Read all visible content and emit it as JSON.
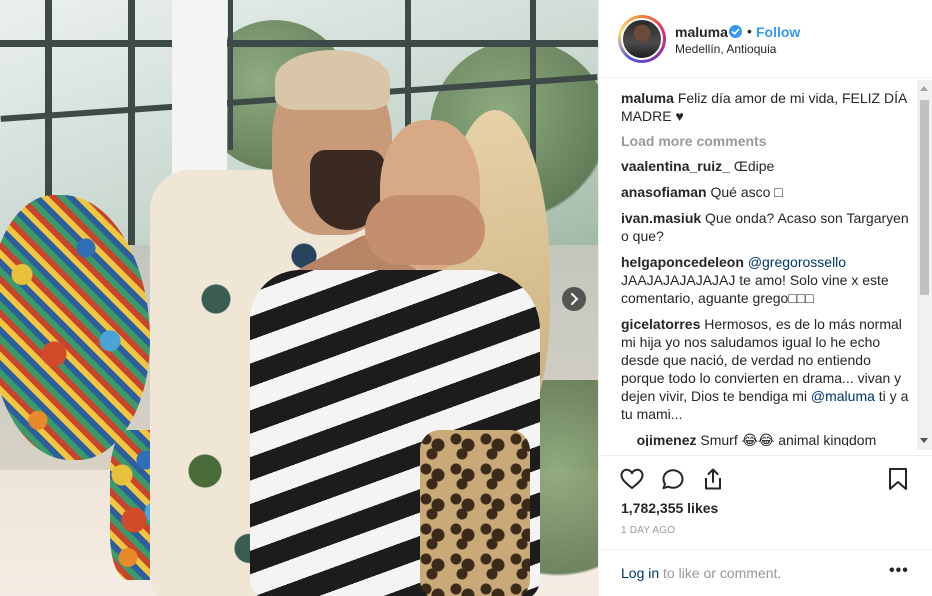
{
  "post": {
    "username": "maluma",
    "follow_label": "Follow",
    "separator": "•",
    "location": "Medellín, Antioquia",
    "caption": {
      "user": "maluma",
      "text": "Feliz día amor de mi vida, FELIZ DÍA MADRE ♥"
    },
    "load_more": "Load more comments",
    "comments": [
      {
        "user": "vaalentina_ruiz_",
        "text": "Œdipe"
      },
      {
        "user": "anasofiaman",
        "text": "Qué asco □"
      },
      {
        "user": "ivan.masiuk",
        "text": "Que onda? Acaso son Targaryen o que?"
      },
      {
        "user": "helgaponcedeleon",
        "mention": "@gregorossello",
        "text": "JAAJAJAJAJAJAJ te amo! Solo vine x este comentario, aguante grego□□□"
      },
      {
        "user": "gicelatorres",
        "text": "Hermosos, es de lo más normal mi hija yo nos saludamos igual lo he echo desde que nació, de verdad no entiendo porque todo lo convierten en drama... vivan y dejen vivir, Dios te bendiga mi",
        "mention": "@maluma",
        "text_after": "ti y a tu mami..."
      },
      {
        "user": "__ojimenez",
        "text": "Smurf 😂😂 animal kingdom"
      }
    ],
    "likes": "1,782,355 likes",
    "time": "1 DAY AGO",
    "login_link": "Log in",
    "login_text": " to like or comment.",
    "more_label": "•••",
    "icons": {
      "like": "heart-icon",
      "comment": "comment-icon",
      "share": "share-icon",
      "save": "bookmark-icon",
      "next": "chevron-right-icon",
      "verified": "verified-badge-icon"
    },
    "colors": {
      "link": "#3897f0",
      "mention": "#003569",
      "muted": "#999999",
      "text": "#262626"
    }
  }
}
